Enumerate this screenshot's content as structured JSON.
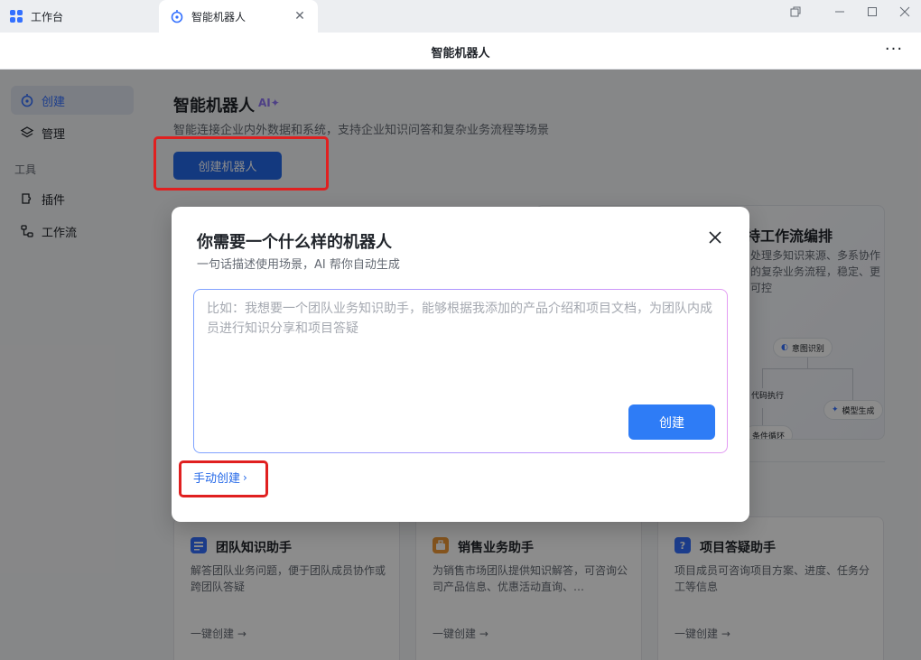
{
  "tabs": [
    {
      "label": "工作台",
      "icon": "app-grid-icon"
    },
    {
      "label": "智能机器人",
      "icon": "robot-icon"
    }
  ],
  "window_title": "智能机器人",
  "sidebar": {
    "items_top": [
      {
        "label": "创建",
        "icon": "robot-icon",
        "active": true
      },
      {
        "label": "管理",
        "icon": "layers-icon",
        "active": false
      }
    ],
    "group_label": "工具",
    "items_tools": [
      {
        "label": "插件",
        "icon": "plugin-icon"
      },
      {
        "label": "工作流",
        "icon": "workflow-icon"
      }
    ]
  },
  "main": {
    "title": "智能机器人",
    "ai_badge": "AI",
    "subtitle": "智能连接企业内外数据和系统，支持企业知识问答和复杂业务流程等场景",
    "create_button": "创建机器人",
    "feature": {
      "title": "持工作流编排",
      "desc": "处理多知识来源、多系协作的复杂业务流程，稳定、更可控",
      "nodes": [
        "意图识别",
        "代码执行",
        "模型生成",
        "条件循环"
      ]
    },
    "templates": [
      {
        "name": "团队知识助手",
        "desc": "解答团队业务问题，便于团队成员协作或跨团队答疑",
        "link": "一键创建 →",
        "color": "#3370ff",
        "icon": "doc-stack-icon"
      },
      {
        "name": "销售业务助手",
        "desc": "为销售市场团队提供知识解答，可咨询公司产品信息、优惠活动直询、…",
        "link": "一键创建 →",
        "color": "#f09a37",
        "icon": "briefcase-icon"
      },
      {
        "name": "项目答疑助手",
        "desc": "项目成员可咨询项目方案、进度、任务分工等信息",
        "link": "一键创建 →",
        "color": "#3370ff",
        "icon": "question-icon"
      }
    ]
  },
  "modal": {
    "title": "你需要一个什么样的机器人",
    "subtitle": "一句话描述使用场景，AI 帮你自动生成",
    "placeholder": "比如：我想要一个团队业务知识助手，能够根据我添加的产品介绍和项目文档，为团队内成员进行知识分享和项目答疑",
    "submit": "创建",
    "manual": "手动创建"
  },
  "colors": {
    "primary": "#2468e8",
    "highlight": "#e02020"
  }
}
